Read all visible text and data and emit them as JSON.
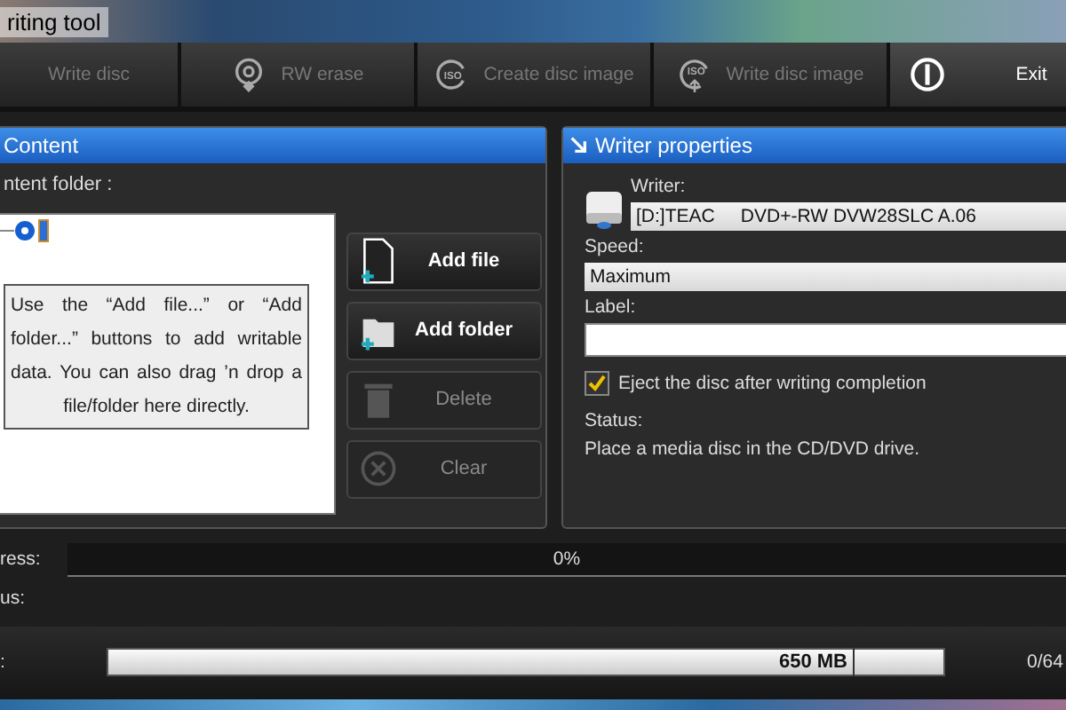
{
  "window": {
    "title": "riting tool"
  },
  "toolbar": [
    {
      "label": "Write disc",
      "kind": "none",
      "disabled": true
    },
    {
      "label": "RW erase",
      "kind": "erase",
      "disabled": true
    },
    {
      "label": "Create disc image",
      "kind": "iso",
      "icon_text": "ISO",
      "disabled": true
    },
    {
      "label": "Write disc image",
      "kind": "iso-up",
      "icon_text": "ISO",
      "disabled": true
    },
    {
      "label": "Exit",
      "kind": "power",
      "disabled": false
    }
  ],
  "content": {
    "title": "Content",
    "folder_label": "ntent folder :",
    "hint": "Use the “Add file...” or “Add folder...” buttons to add writable data. You can also drag ’n drop a file/folder here directly.",
    "buttons": [
      {
        "label": "Add file",
        "kind": "file",
        "disabled": false
      },
      {
        "label": "Add folder",
        "kind": "folder",
        "disabled": false
      },
      {
        "label": "Delete",
        "kind": "trash",
        "disabled": true
      },
      {
        "label": "Clear",
        "kind": "clear",
        "disabled": true
      }
    ]
  },
  "writer": {
    "title": "Writer properties",
    "writer_label": "Writer:",
    "writer_value": "[D:]TEAC     DVD+-RW DVW28SLC A.06",
    "speed_label": "Speed:",
    "speed_value": "Maximum",
    "label_label": "Label:",
    "eject": {
      "label": "Eject the disc after writing completion",
      "checked": true
    },
    "status_label": "Status:",
    "status_text": "Place a media disc in the CD/DVD drive."
  },
  "progress": {
    "label": "ress:",
    "level": 0,
    "reading": "0%"
  },
  "status": {
    "label": "us:"
  },
  "capacity": {
    "label": ":",
    "marker": "650 MB",
    "reading": "0/64"
  }
}
